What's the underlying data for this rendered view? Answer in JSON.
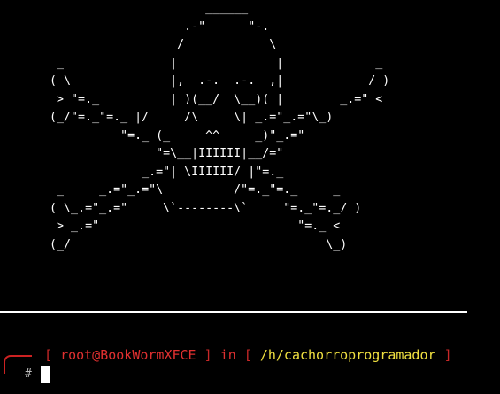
{
  "terminal": {
    "background": "#000000",
    "ascii_art": "                             ______\n                          .-\"      \"-.\n                         /            \\\n        _               |              |             _\n       ( \\              |,  .-.  .-.  ,|            / )\n        > \"=._          | )(__/  \\__)( |        _.=\" <\n       (_/\"=._\"=._ |/     /\\     \\| _.=\"_.=\"\\_)\n                 \"=._ (_     ^^     _)\"_.=\"\n                      \"=\\__|IIIIII|__/=\"\n                    _.=\"| \\IIIIII/ |\"=._\n        _     _.=\"_.=\"\\          /\"=._\"=._     _\n       ( \\_.=\"_.=\"     \\`--------\\`     \"=._\"=._/ )\n        > _.=\"                            \"=._ <\n       (_/                                    \\_)"
  },
  "prompt": {
    "open_bracket": "[",
    "user_host": "root@BookWormXFCE",
    "close_bracket": "]",
    "in_label": "in",
    "path_open_bracket": "[",
    "path": "/h/cachorroprogramador",
    "path_close_bracket": "]",
    "symbol": "#",
    "input_value": ""
  },
  "colors": {
    "prompt_red": "#e03030",
    "path_yellow": "#f0e040",
    "text_white": "#ffffff"
  }
}
